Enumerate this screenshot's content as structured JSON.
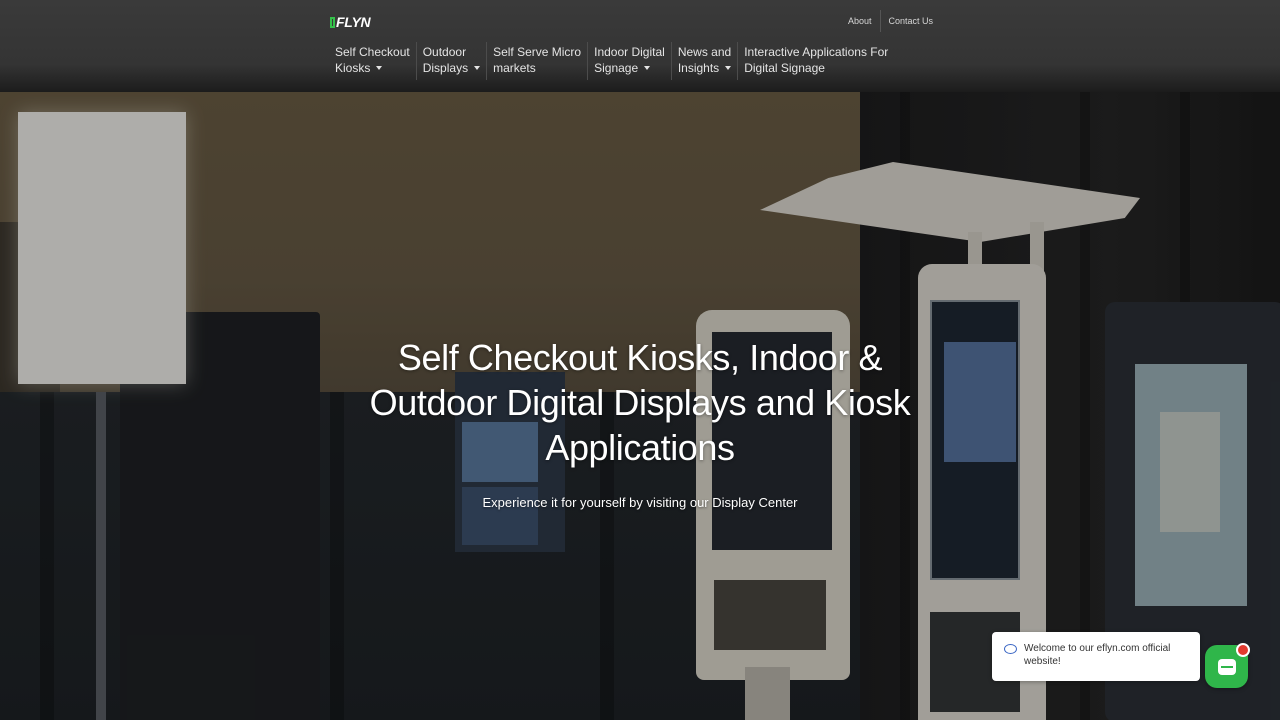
{
  "brand": {
    "logo_text": "FLYN",
    "accent_color": "#35c04a"
  },
  "top_links": [
    {
      "label": "About"
    },
    {
      "label": "Contact Us"
    }
  ],
  "nav": [
    {
      "line1": "Self Checkout",
      "line2": "Kiosks",
      "dropdown": true
    },
    {
      "line1": "Outdoor",
      "line2": "Displays",
      "dropdown": true
    },
    {
      "line1": "Self Serve Micro",
      "line2": "markets",
      "dropdown": false
    },
    {
      "line1": "Indoor Digital",
      "line2": "Signage",
      "dropdown": true
    },
    {
      "line1": "News and",
      "line2": "Insights",
      "dropdown": true
    },
    {
      "line1": "Interactive Applications For",
      "line2": "Digital Signage",
      "dropdown": false
    }
  ],
  "hero": {
    "title_line1": "Self Checkout Kiosks, Indoor &",
    "title_line2": "Outdoor Digital Displays and Kiosk",
    "title_line3": "Applications",
    "subtitle": "Experience it for yourself by visiting our Display Center"
  },
  "chat": {
    "welcome_message": "Welcome to our eflyn.com official website!",
    "button_icon": "chat-icon",
    "button_color": "#2fb64a",
    "badge_color": "#e23a2f"
  }
}
